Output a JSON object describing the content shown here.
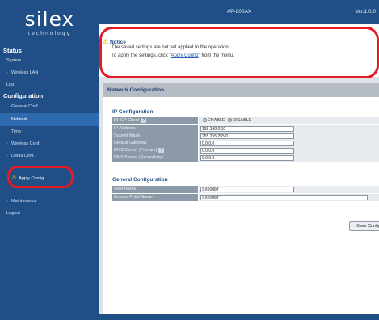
{
  "logo": {
    "main": "silex",
    "sub": "technology"
  },
  "header": {
    "model": "AP-800AX",
    "version": "Ver.1.0.0"
  },
  "sidebar": {
    "status_header": "Status",
    "system": "System",
    "wireless_lan": "Wireless LAN",
    "log": "Log",
    "configuration_header": "Configuration",
    "general_conf": "General Conf.",
    "network": "Network",
    "time": "Time",
    "wireless_conf": "Wireless Conf.",
    "detail_conf": "Detail Conf.",
    "apply_config": "Apply Config",
    "maintenance": "Maintenance",
    "logout": "Logout"
  },
  "notice": {
    "title": "Notice",
    "line1": "The saved settings are not yet applied to the operation.",
    "line2_prefix": "To apply the settings, click \"",
    "line2_link": "Apply Config",
    "line2_suffix": "\" from the menu."
  },
  "panel": {
    "title": "Network Configuration"
  },
  "ip_config": {
    "title": "IP Configuration",
    "dhcp_label": "DHCP Client",
    "dhcp_enable": "ENABLE",
    "dhcp_disable": "DISABLE",
    "dhcp_selected": "DISABLE",
    "ip_label": "IP Address",
    "ip_value": "192.168.0.10",
    "mask_label": "Subnet Mask",
    "mask_value": "255.255.255.0",
    "gateway_label": "Default Gateway",
    "gateway_value": "0.0.0.0",
    "dns1_label": "DNS Server (Primary)",
    "dns1_value": "0.0.0.0",
    "dns2_label": "DNS Server (Secondary)",
    "dns2_value": "0.0.0.0",
    "help_glyph": "?"
  },
  "general_config": {
    "title": "General Configuration",
    "host_label": "Host Name",
    "host_value": "SX0008ff",
    "ap_label": "Access Point Name",
    "ap_value": "SX0008ff"
  },
  "buttons": {
    "save": "Save Config"
  },
  "colors": {
    "sidebar": "#1f4f86",
    "highlight": "#e41b23",
    "warning": "#f3c21b",
    "label_bg": "#8c99a8"
  },
  "icons": {
    "warning": "warning-triangle-icon",
    "help": "help-icon",
    "arrow": "chevron-right-icon"
  }
}
